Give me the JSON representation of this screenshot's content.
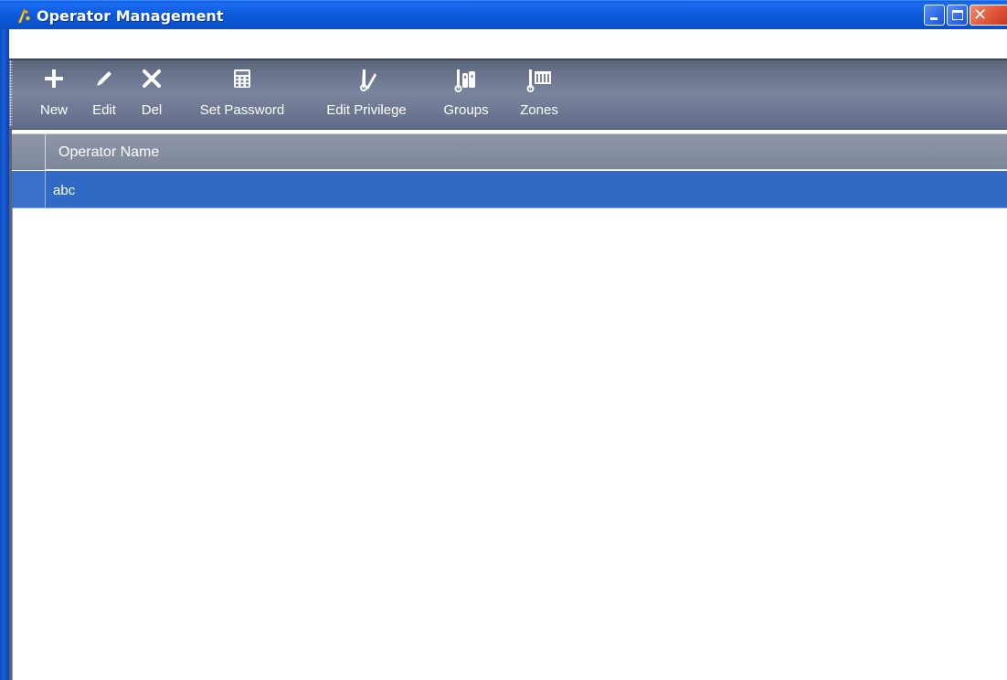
{
  "window": {
    "title": "Operator Management",
    "app_icon": "operator-key-icon",
    "controls": {
      "minimize_icon": "minimize-icon",
      "maximize_icon": "maximize-icon",
      "close_icon": "close-icon",
      "close_glyph": "✕"
    }
  },
  "toolbar": {
    "items": [
      {
        "label": "New",
        "icon": "plus-icon"
      },
      {
        "label": "Edit",
        "icon": "pencil-icon"
      },
      {
        "label": "Del",
        "icon": "delete-x-icon"
      },
      {
        "label": "Set Password",
        "icon": "keypad-icon"
      },
      {
        "label": "Edit Privilege",
        "icon": "key-pencil-icon"
      },
      {
        "label": "Groups",
        "icon": "groups-icon"
      },
      {
        "label": "Zones",
        "icon": "zones-icon"
      }
    ]
  },
  "grid": {
    "columns": [
      "Operator Name"
    ],
    "rows": [
      {
        "operator_name": "abc",
        "selected": true
      }
    ]
  },
  "colors": {
    "title_bar": "#0a5ee8",
    "toolbar": "#6e7892",
    "selection": "#316ac5",
    "header": "#8e96a8"
  }
}
